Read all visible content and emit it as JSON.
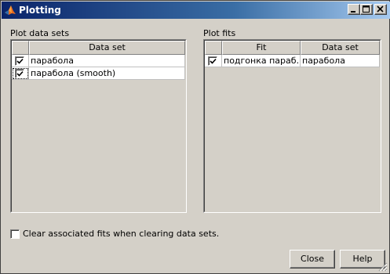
{
  "window": {
    "title": "Plotting"
  },
  "titlebar_buttons": {
    "minimize": "minimize-icon",
    "maximize": "maximize-icon",
    "close": "close-icon"
  },
  "left_panel": {
    "label": "Plot data sets",
    "columns": [
      "",
      "Data set"
    ],
    "rows": [
      {
        "checked": true,
        "data_set": "парабола",
        "focused": false
      },
      {
        "checked": true,
        "data_set": "парабола (smooth)",
        "focused": true
      }
    ]
  },
  "right_panel": {
    "label": "Plot fits",
    "columns": [
      "",
      "Fit",
      "Data set"
    ],
    "rows": [
      {
        "checked": true,
        "fit": "подгонка параб…",
        "data_set": "парабола"
      }
    ]
  },
  "clear_option": {
    "checked": false,
    "label": "Clear associated fits when clearing data sets."
  },
  "buttons": {
    "close": "Close",
    "help": "Help"
  },
  "colors": {
    "title_active": "#0a246a",
    "title_gradient_end": "#a6caf0",
    "face": "#d4d0c8"
  }
}
